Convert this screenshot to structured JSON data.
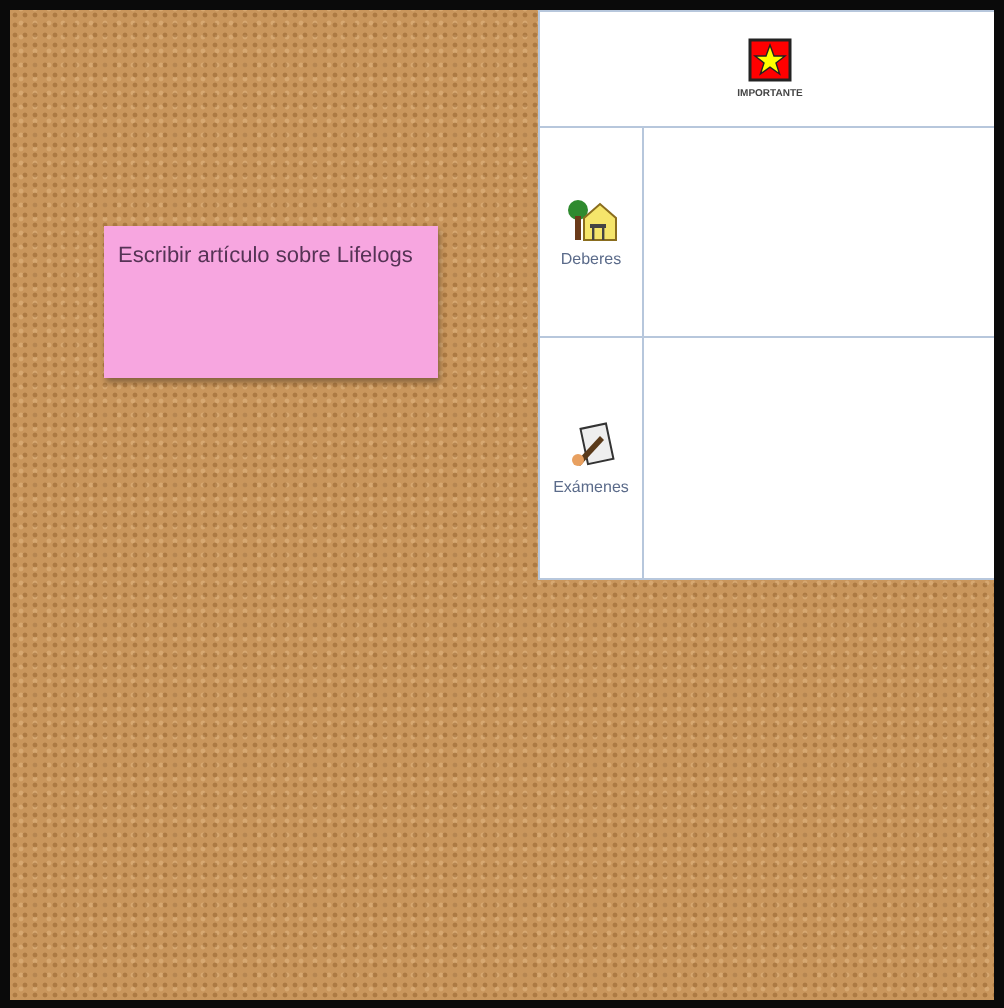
{
  "note": {
    "text": "Escribir artículo sobre Lifelogs",
    "color": "#f7a6e0"
  },
  "matrix": {
    "header": {
      "label": "IMPORTANTE"
    },
    "rows": [
      {
        "label": "Deberes",
        "kind": "homework"
      },
      {
        "label": "Exámenes",
        "kind": "exam"
      }
    ]
  }
}
